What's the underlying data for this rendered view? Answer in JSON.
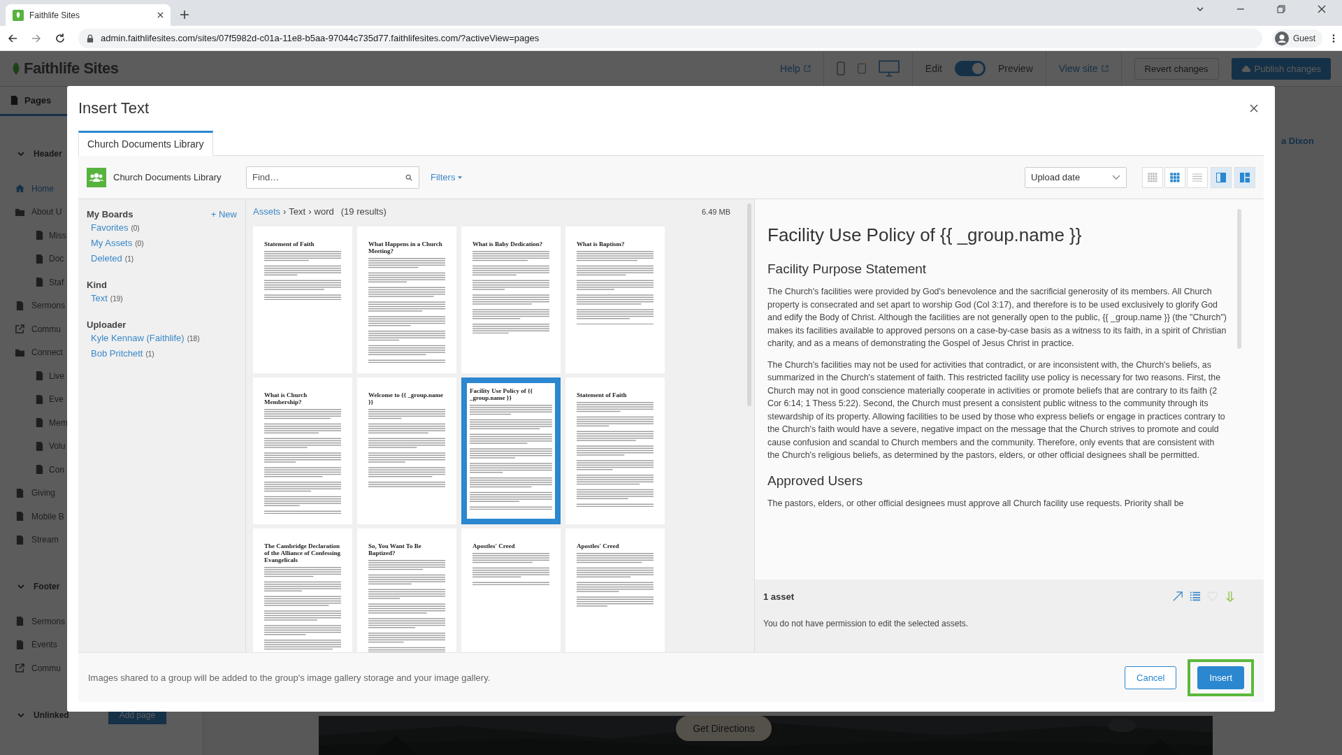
{
  "browser": {
    "tab_title": "Faithlife Sites",
    "url": "admin.faithlifesites.com/sites/07f5982d-c01a-11e8-b5aa-97044c735d77.faithlifesites.com/?activeView=pages",
    "profile": "Guest"
  },
  "app_header": {
    "logo": "Faithlife Sites",
    "help": "Help",
    "edit_label": "Edit",
    "edit_mode": true,
    "preview_label": "Preview",
    "view_site": "View site",
    "revert": "Revert changes",
    "publish": "Publish changes"
  },
  "sidebar": {
    "tab": "Pages",
    "sections": [
      {
        "title": "Header",
        "expanded": true,
        "items": [
          {
            "label": "Home",
            "kind": "home",
            "selected": true
          },
          {
            "label": "About U",
            "kind": "folder",
            "selected": false,
            "children": [
              {
                "label": "Miss",
                "kind": "page",
                "selected": false
              },
              {
                "label": "Doc",
                "kind": "page",
                "selected": false
              },
              {
                "label": "Staf",
                "kind": "page",
                "selected": false
              }
            ]
          },
          {
            "label": "Sermons",
            "kind": "page",
            "selected": false
          },
          {
            "label": "Commu",
            "kind": "link",
            "selected": false
          },
          {
            "label": "Connect",
            "kind": "folder",
            "selected": false,
            "children": [
              {
                "label": "Live",
                "kind": "page",
                "selected": false
              },
              {
                "label": "Eve",
                "kind": "page",
                "selected": false
              },
              {
                "label": "Mem",
                "kind": "page",
                "selected": false
              },
              {
                "label": "Volu",
                "kind": "page",
                "selected": false
              },
              {
                "label": "Con",
                "kind": "page",
                "selected": false
              }
            ]
          },
          {
            "label": "Giving",
            "kind": "page",
            "selected": false
          },
          {
            "label": "Mobile B",
            "kind": "page",
            "selected": false
          },
          {
            "label": "Stream",
            "kind": "page",
            "selected": false
          }
        ]
      },
      {
        "title": "Footer",
        "expanded": true,
        "items": [
          {
            "label": "Sermons",
            "kind": "page",
            "selected": false
          },
          {
            "label": "Events",
            "kind": "page",
            "selected": false
          },
          {
            "label": "Commu",
            "kind": "link",
            "selected": false
          }
        ]
      },
      {
        "title": "Unlinked",
        "expanded": true,
        "action": "Add page"
      }
    ]
  },
  "page_behind": {
    "author": "a Dixon",
    "button": "Get Directions"
  },
  "modal": {
    "title": "Insert Text",
    "tabs": [
      {
        "label": "Church Documents Library",
        "selected": true
      }
    ],
    "library": "Church Documents Library",
    "search": {
      "placeholder": "Find…"
    },
    "filters": "Filters",
    "sort": "Upload date",
    "view_buttons": [
      {
        "kind": "small-grid",
        "selected": false
      },
      {
        "kind": "grid",
        "selected": true
      },
      {
        "kind": "list",
        "selected": false
      },
      {
        "kind": "preview-pane",
        "selected": true
      },
      {
        "kind": "split-pane",
        "selected": true
      }
    ],
    "filter_groups": [
      {
        "title": "My Boards",
        "action": "+ New",
        "items": [
          {
            "label": "Favorites",
            "count": "(0)"
          },
          {
            "label": "My Assets",
            "count": "(0)"
          },
          {
            "label": "Deleted",
            "count": "(1)"
          }
        ]
      },
      {
        "title": "Kind",
        "items": [
          {
            "label": "Text",
            "count": "(19)"
          }
        ]
      },
      {
        "title": "Uploader",
        "items": [
          {
            "label": "Kyle Kennaw (Faithlife)",
            "count": "(18)"
          },
          {
            "label": "Bob Pritchett",
            "count": "(1)"
          }
        ]
      }
    ],
    "breadcrumb": [
      {
        "label": "Assets",
        "kind": "link"
      },
      {
        "label": "›",
        "kind": "separator"
      },
      {
        "label": "Text",
        "kind": "item"
      },
      {
        "label": "›",
        "kind": "separator"
      },
      {
        "label": "word",
        "kind": "item"
      }
    ],
    "results": "(19 results)",
    "size": "6.49 MB",
    "documents": [
      {
        "title": "Statement of Faith",
        "selected": false
      },
      {
        "title": "What Happens in a Church Meeting?",
        "selected": false
      },
      {
        "title": "What is Baby Dedication?",
        "selected": false
      },
      {
        "title": "What is Baptism?",
        "selected": false
      },
      {
        "title": "What is Church Membership?",
        "selected": false
      },
      {
        "title": "Welcome to {{ _group.name }}",
        "selected": false
      },
      {
        "title": "Facility Use Policy of {{ _group.name }}",
        "selected": true
      },
      {
        "title": "Statement of Faith",
        "selected": false
      },
      {
        "title": "The Cambridge Declaration of the Alliance of Confessing Evangelicals",
        "selected": false
      },
      {
        "title": "So, You Want To Be Baptized?",
        "selected": false
      },
      {
        "title": "Apostles' Creed",
        "selected": false
      },
      {
        "title": "Apostles' Creed",
        "selected": false
      }
    ],
    "preview": {
      "title": "Facility Use Policy of {{ _group.name }}",
      "blocks": [
        {
          "kind": "heading",
          "text": "Facility Purpose Statement"
        },
        {
          "kind": "paragraph",
          "text": "The Church's facilities were provided by God's benevolence and the sacrificial generosity of its members. All Church property is consecrated and set apart to worship God (Col 3:17), and therefore is to be used exclusively to glorify God and edify the Body of Christ. Although the facilities are not generally open to the public, {{ _group.name }} (the \"Church\") makes its facilities available to approved persons on a case-by-case basis as a witness to its faith, in a spirit of Christian charity, and as a means of demonstrating the Gospel of Jesus Christ in practice."
        },
        {
          "kind": "paragraph",
          "text": "The Church's facilities may not be used for activities that contradict, or are inconsistent with, the Church's beliefs, as summarized in the Church's statement of faith. This restricted facility use policy is necessary for two reasons. First, the Church may not in good conscience materially cooperate in activities or promote beliefs that are contrary to its faith (2 Cor 6:14; 1 Thess 5:22). Second, the Church must present a consistent public witness to the community through its stewardship of its property. Allowing facilities to be used by those who express beliefs or engage in practices contrary to the Church's faith would have a severe, negative impact on the message that the Church strives to promote and could cause confusion and scandal to Church members and the community. Therefore, only events that are consistent with the Church's religious beliefs, as determined by the pastors, elders, or other official designees shall be permitted."
        },
        {
          "kind": "heading",
          "text": "Approved Users"
        },
        {
          "kind": "paragraph",
          "text": "The pastors, elders, or other official designees must approve all Church facility use requests. Priority shall be"
        }
      ]
    },
    "asset_count": "1 asset",
    "asset_actions": [
      {
        "kind": "open"
      },
      {
        "kind": "details"
      },
      {
        "kind": "favorite"
      },
      {
        "kind": "download"
      }
    ],
    "permission_note": "You do not have permission to edit the selected assets.",
    "footer_note": "Images shared to a group will be added to the group's image gallery storage and your image gallery.",
    "buttons": [
      {
        "label": "Cancel",
        "kind": "secondary",
        "highlighted": false
      },
      {
        "label": "Insert",
        "kind": "primary",
        "highlighted": true
      }
    ]
  }
}
